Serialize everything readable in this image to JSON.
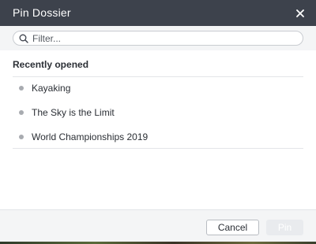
{
  "dialog": {
    "title": "Pin Dossier",
    "close_icon": "close-icon"
  },
  "search": {
    "placeholder": "Filter...",
    "value": "",
    "icon": "search-icon"
  },
  "recent": {
    "heading": "Recently opened",
    "items": [
      {
        "label": "Kayaking"
      },
      {
        "label": "The Sky is the Limit"
      },
      {
        "label": "World Championships 2019"
      }
    ]
  },
  "footer": {
    "cancel_label": "Cancel",
    "pin_label": "Pin"
  },
  "colors": {
    "title_bar": "#3d424c",
    "bullet": "#a8abb0",
    "pin_disabled": "#e9ebee"
  }
}
